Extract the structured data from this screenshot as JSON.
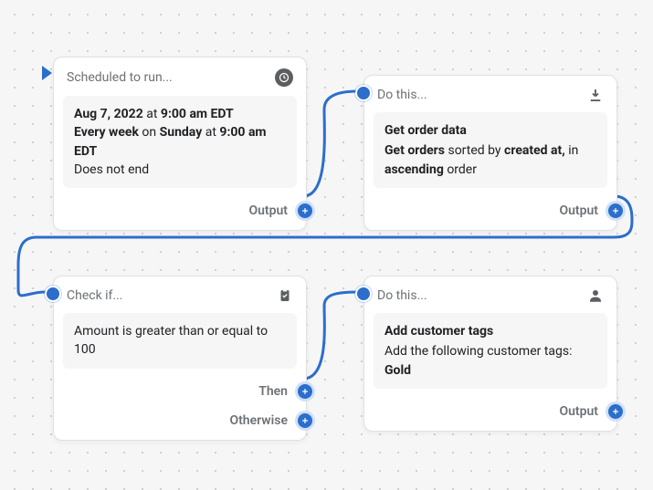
{
  "start_date": "Aug 7, 2022",
  "at_word": "at",
  "start_time": "9:00 am EDT",
  "recurrence_prefix": "Every week",
  "on_word": "on",
  "recurrence_day": "Sunday",
  "recurrence_time": "9:00 am EDT",
  "does_not_end": "Does not end",
  "node1": {
    "header": "Scheduled to run...",
    "output_label": "Output"
  },
  "node2": {
    "header": "Do this...",
    "title": "Get order data",
    "get_orders": "Get orders",
    "sorted_by": "sorted by",
    "sort_field": "created at,",
    "in_word": "in",
    "sort_dir": "ascending",
    "order_word": "order",
    "output_label": "Output"
  },
  "node3": {
    "header": "Check if...",
    "condition": "Amount is greater than or equal to 100",
    "then_label": "Then",
    "otherwise_label": "Otherwise"
  },
  "node4": {
    "header": "Do this...",
    "title": "Add customer tags",
    "desc": "Add the following customer tags:",
    "tag": "Gold",
    "output_label": "Output"
  }
}
